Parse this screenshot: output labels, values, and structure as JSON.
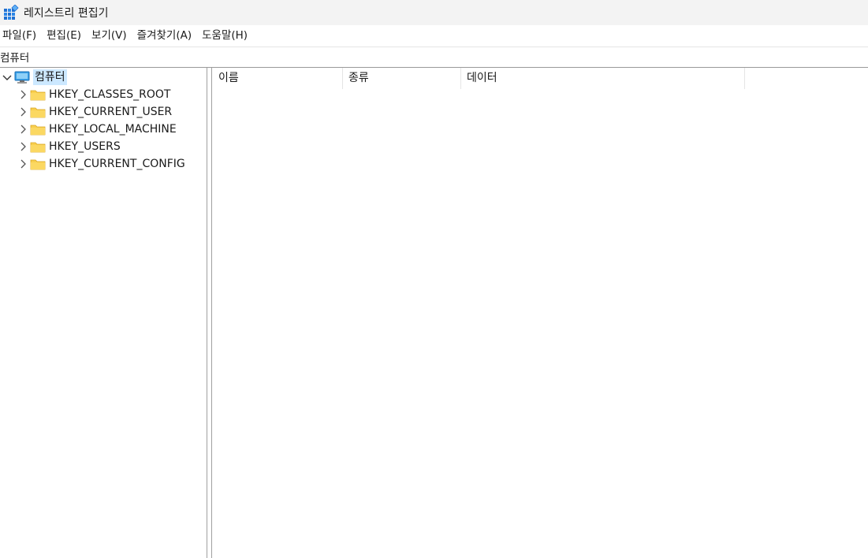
{
  "window": {
    "title": "레지스트리 편집기",
    "icon": "registry-editor-icon"
  },
  "menu": [
    {
      "label": "파일(F)"
    },
    {
      "label": "편집(E)"
    },
    {
      "label": "보기(V)"
    },
    {
      "label": "즐겨찾기(A)"
    },
    {
      "label": "도움말(H)"
    }
  ],
  "address": {
    "value": "컴퓨터"
  },
  "tree": {
    "root": {
      "label": "컴퓨터",
      "icon": "computer-icon",
      "expanded": true
    },
    "keys": [
      {
        "label": "HKEY_CLASSES_ROOT",
        "icon": "folder-icon"
      },
      {
        "label": "HKEY_CURRENT_USER",
        "icon": "folder-icon"
      },
      {
        "label": "HKEY_LOCAL_MACHINE",
        "icon": "folder-icon"
      },
      {
        "label": "HKEY_USERS",
        "icon": "folder-icon"
      },
      {
        "label": "HKEY_CURRENT_CONFIG",
        "icon": "folder-icon"
      }
    ]
  },
  "list": {
    "columns": [
      {
        "label": "이름"
      },
      {
        "label": "종류"
      },
      {
        "label": "데이터"
      }
    ]
  },
  "colors": {
    "selection": "#cce8ff",
    "folder": "#f8cf4f",
    "titlebar": "#f3f3f3"
  }
}
